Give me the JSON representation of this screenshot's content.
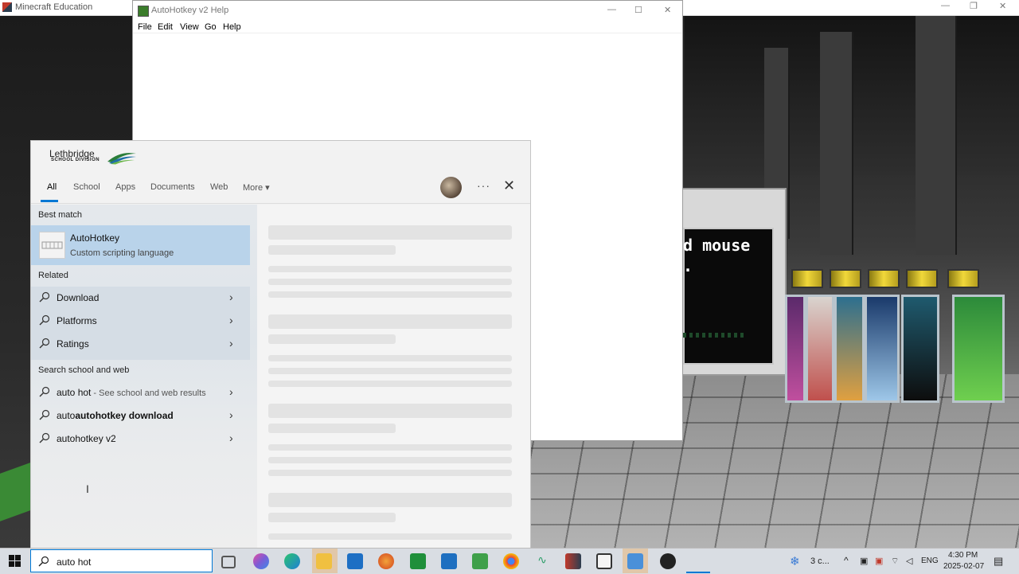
{
  "minecraft_window": {
    "title": "Minecraft Education"
  },
  "ahk_window": {
    "title": "AutoHotkey v2 Help",
    "menus": [
      "File",
      "Edit",
      "View",
      "Go",
      "Help"
    ]
  },
  "game_screen_text": {
    "line1": "d mouse",
    "line2": "."
  },
  "search_panel": {
    "logo_name": "Lethbridge",
    "logo_sub": "SCHOOL DIVISION",
    "tabs": [
      "All",
      "School",
      "Apps",
      "Documents",
      "Web",
      "More"
    ],
    "more_caret": "▾",
    "menu_dots": "···",
    "close": "✕",
    "best_match_heading": "Best match",
    "best_match": {
      "name": "AutoHotkey",
      "subtitle": "Custom scripting language",
      "icon": "autohotkey-app-icon"
    },
    "related_heading": "Related",
    "related": [
      "Download",
      "Platforms",
      "Ratings"
    ],
    "web_heading": "Search school and web",
    "web_results": [
      {
        "query": "auto hot",
        "suffix": " - See school and web results"
      },
      {
        "query": "autohotkey download",
        "suffix": ""
      },
      {
        "query": "autohotkey v2",
        "suffix": ""
      }
    ],
    "chevron": "›"
  },
  "taskbar": {
    "search_value": "auto hot",
    "weather": "3 c...",
    "language": "ENG",
    "time": "4:30 PM",
    "date": "2025-02-07",
    "accent": "#0078d4"
  }
}
